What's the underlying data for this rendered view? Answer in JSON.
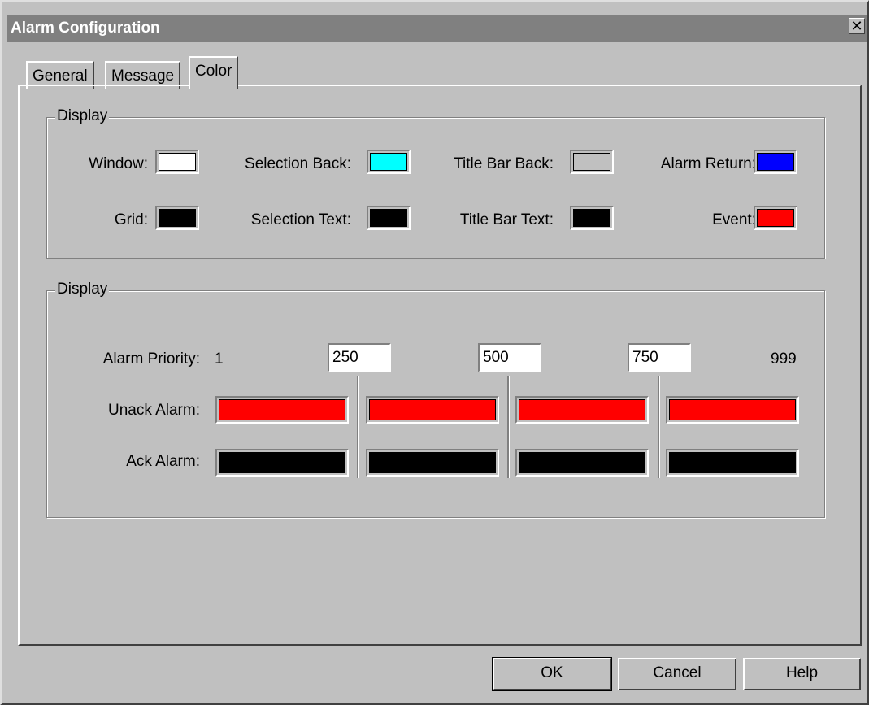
{
  "window": {
    "title": "Alarm Configuration",
    "close_glyph": "✕",
    "close_icon": "close-icon"
  },
  "tabs": [
    {
      "label": "General",
      "active": false
    },
    {
      "label": "Message",
      "active": false
    },
    {
      "label": "Color",
      "active": true
    }
  ],
  "display_group": {
    "legend": "Display",
    "items": [
      {
        "label": "Window:",
        "color": "#ffffff"
      },
      {
        "label": "Selection Back:",
        "color": "#00ffff"
      },
      {
        "label": "Title Bar Back:",
        "color": "#c0c0c0"
      },
      {
        "label": "Alarm Return:",
        "color": "#0000ff"
      },
      {
        "label": "Grid:",
        "color": "#000000"
      },
      {
        "label": "Selection Text:",
        "color": "#000000"
      },
      {
        "label": "Title Bar Text:",
        "color": "#000000"
      },
      {
        "label": "Event:",
        "color": "#ff0000"
      }
    ]
  },
  "priority_group": {
    "legend": "Display",
    "priority_label": "Alarm Priority:",
    "priority_start": "1",
    "priority_end": "999",
    "thresholds": [
      "250",
      "500",
      "750"
    ],
    "unack_label": "Unack Alarm:",
    "ack_label": "Ack Alarm:",
    "unack_colors": [
      "#ff0000",
      "#ff0000",
      "#ff0000",
      "#ff0000"
    ],
    "ack_colors": [
      "#000000",
      "#000000",
      "#000000",
      "#000000"
    ]
  },
  "buttons": {
    "ok": "OK",
    "cancel": "Cancel",
    "help": "Help"
  }
}
